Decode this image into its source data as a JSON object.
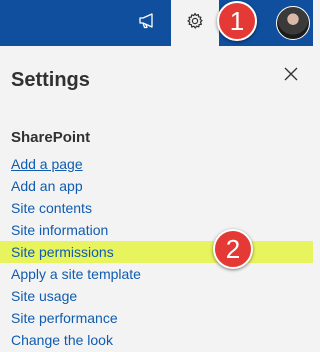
{
  "topbar": {
    "icons": {
      "megaphone": "megaphone-icon",
      "gear": "gear-icon",
      "avatar": "user-avatar"
    },
    "brand_color": "#0f4f9e"
  },
  "annotations": {
    "badge1": "1",
    "badge2": "2",
    "color": "#e53935"
  },
  "panel": {
    "title": "Settings",
    "section_heading": "SharePoint",
    "links": [
      "Add a page",
      "Add an app",
      "Site contents",
      "Site information",
      "Site permissions",
      "Apply a site template",
      "Site usage",
      "Site performance",
      "Change the look"
    ],
    "highlight_color": "#e8f45e",
    "link_color": "#0f5cb0"
  }
}
